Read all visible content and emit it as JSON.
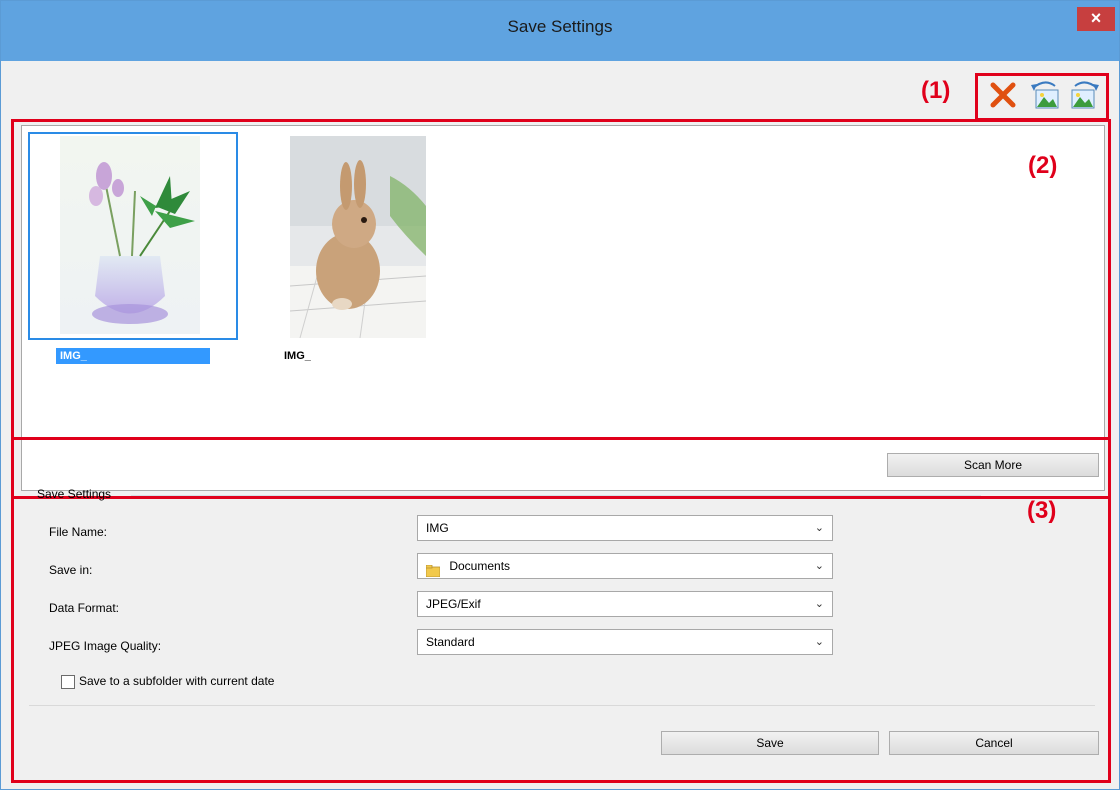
{
  "window": {
    "title": "Save Settings",
    "close_glyph": "×"
  },
  "callouts": {
    "toolbar": "(1)",
    "thumbnails": "(2)",
    "settings": "(3)"
  },
  "toolbar": {
    "icons": [
      "delete-icon",
      "rotate-left-icon",
      "rotate-right-icon"
    ]
  },
  "thumbnails": [
    {
      "label": "IMG_",
      "selected": true,
      "image": "flower-vase-image"
    },
    {
      "label": "IMG_",
      "selected": false,
      "image": "rabbit-image"
    }
  ],
  "buttons": {
    "scan_more": "Scan More",
    "save": "Save",
    "cancel": "Cancel"
  },
  "save_settings": {
    "group_title": "Save Settings",
    "file_name": {
      "label": "File Name:",
      "value": "IMG"
    },
    "save_in": {
      "label": "Save in:",
      "value": "Documents",
      "icon": "folder-icon"
    },
    "data_format": {
      "label": "Data Format:",
      "value": "JPEG/Exif"
    },
    "jpeg_quality": {
      "label": "JPEG Image Quality:",
      "value": "Standard"
    },
    "subfolder_checkbox": {
      "label": "Save to a subfolder with current date",
      "checked": false
    }
  },
  "colors": {
    "titlebar": "#5fa3e0",
    "callout_red": "#e0001b",
    "selection_blue": "#3399ff"
  }
}
